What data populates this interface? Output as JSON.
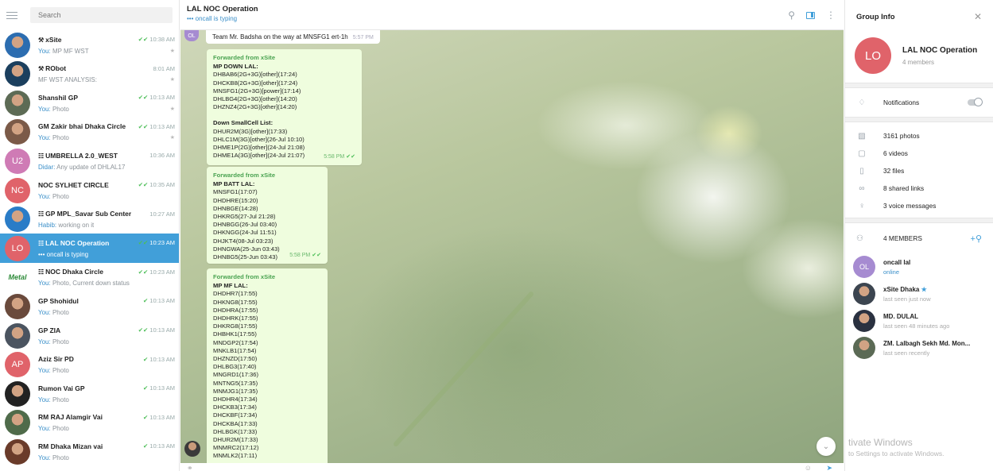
{
  "sidebar": {
    "search_placeholder": "Search",
    "chats": [
      {
        "name": "xSite",
        "time": "10:38 AM",
        "you": "You:",
        "preview": " MP MF WST",
        "check": "✔✔",
        "pinned": true,
        "group": false,
        "bot": true,
        "avatar": {
          "initials": "",
          "color": "#2c6db0"
        }
      },
      {
        "name": "RObot",
        "time": "8:01 AM",
        "you": "",
        "preview": "MF WST ANALYSIS:",
        "check": "",
        "pinned": true,
        "group": false,
        "bot": true,
        "avatar": {
          "initials": "",
          "color": "#1b3f5e"
        }
      },
      {
        "name": "Shanshil GP",
        "time": "10:13 AM",
        "you": "You:",
        "preview": " Photo",
        "check": "✔✔",
        "pinned": true,
        "group": false,
        "bot": false,
        "avatar": {
          "initials": "",
          "color": "#5d6b55"
        }
      },
      {
        "name": "GM Zakir bhai Dhaka Circle",
        "time": "10:13 AM",
        "you": "You:",
        "preview": " Photo",
        "check": "✔✔",
        "pinned": true,
        "group": false,
        "bot": false,
        "avatar": {
          "initials": "",
          "color": "#7b5a48"
        }
      },
      {
        "name": "UMBRELLA 2.0_WEST",
        "time": "10:36 AM",
        "you": "Didar:",
        "preview": " Any update of DHLAL17",
        "check": "",
        "pinned": false,
        "group": true,
        "bot": false,
        "avatar": {
          "initials": "U2",
          "color": "#cf7bb5"
        }
      },
      {
        "name": "NOC SYLHET CIRCLE",
        "time": "10:35 AM",
        "you": "You:",
        "preview": " Photo",
        "check": "✔✔",
        "pinned": false,
        "group": false,
        "bot": false,
        "avatar": {
          "initials": "NC",
          "color": "#e0636a"
        }
      },
      {
        "name": "GP MPL_Savar Sub Center",
        "time": "10:27 AM",
        "you": "Habib:",
        "preview": " working on it",
        "check": "",
        "pinned": false,
        "group": true,
        "bot": false,
        "avatar": {
          "initials": "",
          "color": "#2a7cc7"
        }
      },
      {
        "name": "LAL NOC Operation",
        "time": "10:23 AM",
        "you": "",
        "preview": "••• oncall is typing",
        "check": "✔✔",
        "pinned": false,
        "group": true,
        "bot": false,
        "active": true,
        "avatar": {
          "initials": "LO",
          "color": "#e0636a"
        }
      },
      {
        "name": "NOC Dhaka Circle",
        "time": "10:23 AM",
        "you": "You:",
        "preview": " Photo, Current down status",
        "check": "✔✔",
        "pinned": false,
        "group": true,
        "bot": false,
        "avatar": {
          "initials": "Metal",
          "color": "#ffffff"
        }
      },
      {
        "name": "GP Shohidul",
        "time": "10:13 AM",
        "you": "You:",
        "preview": " Photo",
        "check": "✔",
        "pinned": false,
        "group": false,
        "bot": false,
        "avatar": {
          "initials": "",
          "color": "#6a4a3c"
        }
      },
      {
        "name": "GP ZIA",
        "time": "10:13 AM",
        "you": "You:",
        "preview": " Photo",
        "check": "✔✔",
        "pinned": false,
        "group": false,
        "bot": false,
        "avatar": {
          "initials": "",
          "color": "#4b5460"
        }
      },
      {
        "name": "Aziz Sir PD",
        "time": "10:13 AM",
        "you": "You:",
        "preview": " Photo",
        "check": "✔",
        "pinned": false,
        "group": false,
        "bot": false,
        "avatar": {
          "initials": "AP",
          "color": "#e0636a"
        }
      },
      {
        "name": "Rumon Vai GP",
        "time": "10:13 AM",
        "you": "You:",
        "preview": " Photo",
        "check": "✔",
        "pinned": false,
        "group": false,
        "bot": false,
        "avatar": {
          "initials": "",
          "color": "#222222"
        }
      },
      {
        "name": "RM RAJ Alamgir Vai",
        "time": "10:13 AM",
        "you": "You:",
        "preview": " Photo",
        "check": "✔",
        "pinned": false,
        "group": false,
        "bot": false,
        "avatar": {
          "initials": "",
          "color": "#4f6b4a"
        }
      },
      {
        "name": "RM Dhaka Mizan vai",
        "time": "10:13 AM",
        "you": "You:",
        "preview": " Photo",
        "check": "✔",
        "pinned": false,
        "group": false,
        "bot": false,
        "avatar": {
          "initials": "",
          "color": "#6a3b2a"
        }
      }
    ]
  },
  "chat": {
    "title": "LAL NOC Operation",
    "status": "••• oncall is typing",
    "top_message": {
      "text": "Team Mr. Badsha on the way at MNSFG1 ert-1h",
      "time": "5:57 PM",
      "sender_initials": "OL"
    },
    "messages": [
      {
        "forwarded": "Forwarded from xSite",
        "head": "MP DOWN LAL:",
        "lines": [
          "DHBAB6(2G+3G)[other](17:24)",
          "DHCKB8(2G+3G)[other](17:24)",
          "MNSFG1(2G+3G)[power](17:14)",
          "DHLBG4(2G+3G)[other](14:20)",
          "DHZNZ4(2G+3G)[other](14:20)"
        ],
        "head2": "Down SmallCell List:",
        "lines2": [
          "DHUR2M(3G)[other](17:33)",
          "DHLC1M(3G)[other](26-Jul 10:10)",
          "DHME1P(2G)[other](24-Jul 21:08)",
          "DHME1A(3G)[other](24-Jul 21:07)"
        ],
        "time": "5:58 PM"
      },
      {
        "forwarded": "Forwarded from xSite",
        "head": "MP BATT LAL:",
        "lines": [
          "MNSFG1(17:07)",
          "DHDHRE(15:20)",
          "DHNBGE(14:28)",
          "DHKRG5(27-Jul 21:28)",
          "DHNBGG(26-Jul 03:40)",
          "DHKNGG(24-Jul 11:51)",
          "DHJKT4(08-Jul 03:23)",
          "DHNGWA(25-Jun 03:43)",
          "DHNBG5(25-Jun 03:43)"
        ],
        "head2": "",
        "lines2": [],
        "time": "5:58 PM"
      },
      {
        "forwarded": "Forwarded from xSite",
        "head": "MP MF LAL:",
        "lines": [
          "DHDHR7(17:55)",
          "DHKNG8(17:55)",
          "DHDHRA(17:55)",
          "DHDHRK(17:55)",
          "DHKRG8(17:55)",
          "DHBHK1(17:55)",
          "MNDGP2(17:54)",
          "MNKLB1(17:54)",
          "DHZNZD(17:50)",
          "DHLBG3(17:40)",
          "MNGRD1(17:36)",
          "MNTNG5(17:35)",
          "MNMJG1(17:35)",
          "DHDHR4(17:34)",
          "DHCKB3(17:34)",
          "DHCKBF(17:34)",
          "DHCKBA(17:33)",
          "DHLBGK(17:33)",
          "DHUR2M(17:33)",
          "MNMRC2(17:12)",
          "MNMLK2(17:11)"
        ],
        "head2": "",
        "lines2": [],
        "time": ""
      }
    ]
  },
  "info": {
    "header": "Group Info",
    "group_initials": "LO",
    "group_name": "LAL NOC Operation",
    "member_count": "4 members",
    "notifications": "Notifications",
    "media": [
      {
        "icon": "photo-icon",
        "label": "3161 photos"
      },
      {
        "icon": "video-icon",
        "label": "6 videos"
      },
      {
        "icon": "file-icon",
        "label": "32 files"
      },
      {
        "icon": "link-icon",
        "label": "8 shared links"
      },
      {
        "icon": "mic-icon",
        "label": "3 voice messages"
      }
    ],
    "members_header": "4 MEMBERS",
    "members": [
      {
        "initials": "OL",
        "name": "oncall lal",
        "status": "online",
        "online": true,
        "star": false,
        "color": "#a68bd1"
      },
      {
        "initials": "",
        "name": "xSite Dhaka",
        "status": "last seen just now",
        "online": false,
        "star": true,
        "color": "#3c4550"
      },
      {
        "initials": "",
        "name": "MD. DULAL",
        "status": "last seen 48 minutes ago",
        "online": false,
        "star": false,
        "color": "#2a3140"
      },
      {
        "initials": "",
        "name": "ZM. Lalbagh Sekh Md. Mon...",
        "status": "last seen recently",
        "online": false,
        "star": false,
        "color": "#5b6a55"
      }
    ]
  },
  "watermark": {
    "line1": "tivate Windows",
    "line2": "to Settings to activate Windows."
  },
  "colors": {
    "accent": "#419fd9",
    "bubble": "#effdde",
    "forward": "#4aa351",
    "tick": "#4dbe58"
  }
}
